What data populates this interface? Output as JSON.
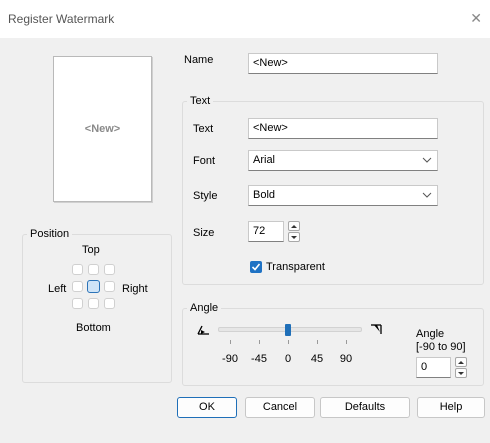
{
  "window": {
    "title": "Register Watermark",
    "close_glyph": "✕"
  },
  "preview": {
    "text": "<New>"
  },
  "name": {
    "label": "Name",
    "value": "<New>"
  },
  "text_group": {
    "legend": "Text",
    "text_label": "Text",
    "text_value": "<New>",
    "font_label": "Font",
    "font_value": "Arial",
    "style_label": "Style",
    "style_value": "Bold",
    "size_label": "Size",
    "size_value": "72",
    "transparent_label": "Transparent",
    "transparent_checked": true
  },
  "position_group": {
    "legend": "Position",
    "top": "Top",
    "left": "Left",
    "right": "Right",
    "bottom": "Bottom",
    "selected": "center"
  },
  "angle_group": {
    "legend": "Angle",
    "ticks": [
      "-90",
      "-45",
      "0",
      "45",
      "90"
    ],
    "slider_value": 0,
    "slider_min": -90,
    "slider_max": 90,
    "angle_label_line1": "Angle",
    "angle_label_line2": "[-90 to 90]",
    "angle_value": "0"
  },
  "buttons": {
    "ok": "OK",
    "cancel": "Cancel",
    "defaults": "Defaults",
    "help": "Help"
  },
  "colors": {
    "accent": "#1f6fb8",
    "checkbox": "#1f72c4"
  },
  "icons": {
    "angle_min": "angle-minus-icon",
    "angle_max": "angle-plus-icon",
    "spin_up": "spin-up-icon",
    "spin_down": "spin-down-icon",
    "dropdown": "chevron-down-icon"
  }
}
